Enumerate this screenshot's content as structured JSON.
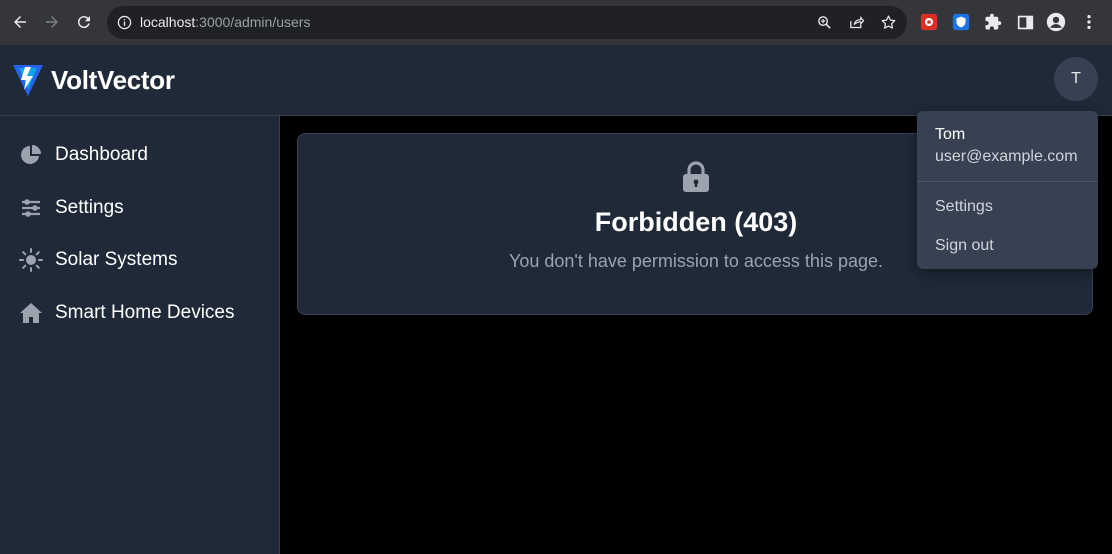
{
  "browser": {
    "url_host": "localhost",
    "url_rest": ":3000/admin/users",
    "icons": [
      "back-icon",
      "forward-icon",
      "reload-icon",
      "info-icon",
      "zoom-icon",
      "share-icon",
      "bookmark-star-icon",
      "extension-red-icon",
      "extension-shield-icon",
      "puzzle-icon",
      "side-panel-icon",
      "profile-icon",
      "menu-dots-icon"
    ]
  },
  "header": {
    "brand": "VoltVector",
    "avatar_initial": "T"
  },
  "sidebar": {
    "items": [
      {
        "label": "Dashboard",
        "icon": "pie-chart-icon"
      },
      {
        "label": "Settings",
        "icon": "sliders-icon"
      },
      {
        "label": "Solar Systems",
        "icon": "sun-icon"
      },
      {
        "label": "Smart Home Devices",
        "icon": "home-icon"
      }
    ]
  },
  "main": {
    "title": "Forbidden (403)",
    "message": "You don't have permission to access this page."
  },
  "user_menu": {
    "name": "Tom",
    "email": "user@example.com",
    "items": [
      "Settings",
      "Sign out"
    ]
  },
  "colors": {
    "panel": "#1f2937",
    "border": "#374151",
    "menu": "#374151",
    "muted": "#9ca3af"
  }
}
